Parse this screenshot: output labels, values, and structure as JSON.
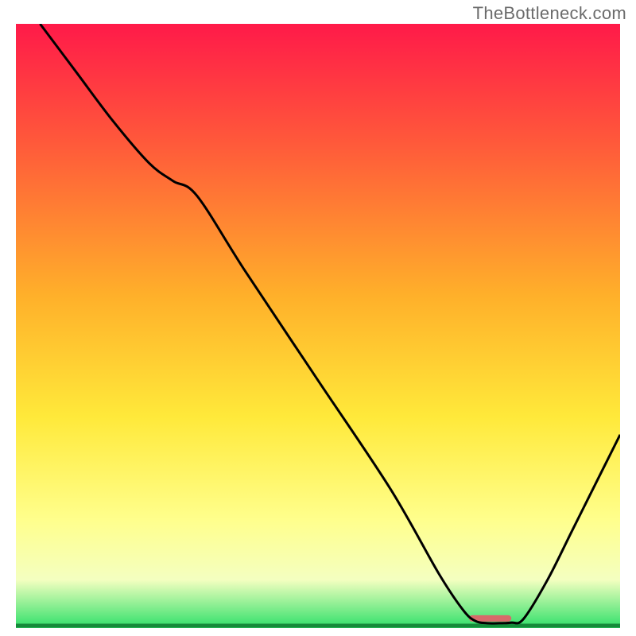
{
  "watermark": "TheBottleneck.com",
  "chart_data": {
    "type": "line",
    "title": "",
    "xlabel": "",
    "ylabel": "",
    "xlim": [
      0,
      100
    ],
    "ylim": [
      0,
      100
    ],
    "background_gradient": {
      "stops": [
        {
          "offset": 0.0,
          "color": "#ff1a49"
        },
        {
          "offset": 0.2,
          "color": "#ff5a3a"
        },
        {
          "offset": 0.45,
          "color": "#ffb02a"
        },
        {
          "offset": 0.65,
          "color": "#ffe93a"
        },
        {
          "offset": 0.82,
          "color": "#ffff8c"
        },
        {
          "offset": 0.92,
          "color": "#f4ffc0"
        },
        {
          "offset": 1.0,
          "color": "#2fe06a"
        }
      ]
    },
    "curve": {
      "x": [
        4,
        10,
        16,
        22,
        26,
        30,
        38,
        50,
        62,
        70,
        74,
        76,
        78,
        80,
        82,
        84,
        88,
        92,
        96,
        100
      ],
      "y": [
        100,
        92,
        84,
        77,
        74,
        71.5,
        59,
        41,
        23,
        9,
        3,
        1.2,
        0.8,
        0.8,
        0.9,
        1.5,
        8,
        16,
        24,
        32
      ]
    },
    "marker_segment": {
      "x0": 75,
      "x1": 82,
      "y": 1.6,
      "color": "#d86a6a",
      "thickness": 8
    },
    "baseline_y": 0.4,
    "baseline_color": "#158a3a"
  }
}
